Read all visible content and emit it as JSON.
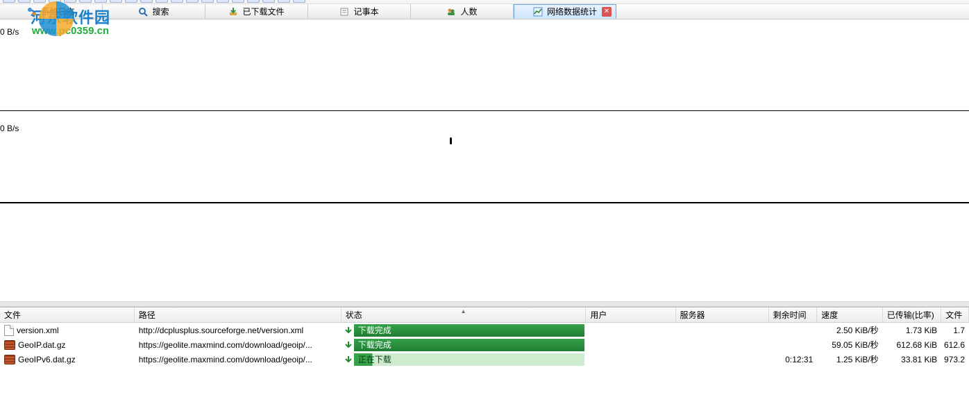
{
  "watermark": {
    "title": "河东软件园",
    "url": "www.pc0359.cn"
  },
  "tabs": [
    {
      "id": "syslog",
      "label": "系统日志",
      "icon": "log-icon",
      "active": false,
      "closable": false
    },
    {
      "id": "search",
      "label": "搜索",
      "icon": "search-icon",
      "active": false,
      "closable": false
    },
    {
      "id": "download",
      "label": "已下载文件",
      "icon": "download-icon",
      "active": false,
      "closable": false
    },
    {
      "id": "notepad",
      "label": "记事本",
      "icon": "notepad-icon",
      "active": false,
      "closable": false
    },
    {
      "id": "users",
      "label": "人数",
      "icon": "users-icon",
      "active": false,
      "closable": false
    },
    {
      "id": "netstat",
      "label": "网络数据统计",
      "icon": "chart-icon",
      "active": true,
      "closable": true
    }
  ],
  "graph": {
    "pane1_label": "0 B/s",
    "pane2_label": "0 B/s"
  },
  "transfers": {
    "columns": {
      "file": "文件",
      "path": "路径",
      "status": "状态",
      "user": "用户",
      "server": "服务器",
      "remain": "剩余时间",
      "speed": "速度",
      "xfer": "已传输(比率)",
      "last": "文件"
    },
    "sort_indicator": "▲",
    "rows": [
      {
        "icon": "file",
        "file": "version.xml",
        "path": "http://dcplusplus.sourceforge.net/version.xml",
        "status_text": "下载完成",
        "status_kind": "done",
        "user": "",
        "server": "",
        "remain": "",
        "speed": "2.50 KiB/秒",
        "xfer": "1.73 KiB",
        "last": "1.7"
      },
      {
        "icon": "gz",
        "file": "GeoIP.dat.gz",
        "path": "https://geolite.maxmind.com/download/geoip/...",
        "status_text": "下载完成",
        "status_kind": "done",
        "user": "",
        "server": "",
        "remain": "",
        "speed": "59.05 KiB/秒",
        "xfer": "612.68 KiB",
        "last": "612.6"
      },
      {
        "icon": "gz",
        "file": "GeoIPv6.dat.gz",
        "path": "https://geolite.maxmind.com/download/geoip/...",
        "status_text": "正在下载",
        "status_kind": "prog",
        "user": "",
        "server": "",
        "remain": "0:12:31",
        "speed": "1.25 KiB/秒",
        "xfer": "33.81 KiB",
        "last": "973.2"
      }
    ]
  }
}
